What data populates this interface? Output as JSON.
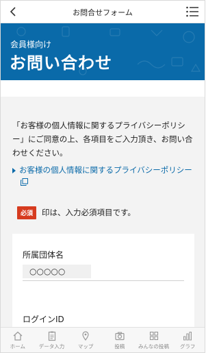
{
  "header": {
    "title": "お問合せフォーム"
  },
  "hero": {
    "subtitle": "会員様向け",
    "title": "お問い合わせ"
  },
  "intro": {
    "text": "「お客様の個人情報に関するプライバシーポリシー」にご同意の上、各項目をご入力頂き、お問い合わせください。"
  },
  "policy_link": {
    "label": "お客様の個人情報に関するプライバシーポリシー"
  },
  "required_note": {
    "badge": "必須",
    "text": "印は、入力必須項目です。"
  },
  "form": {
    "fields": [
      {
        "label": "所属団体名",
        "value": "○○○○○"
      },
      {
        "label": "ログインID",
        "value": ""
      }
    ]
  },
  "tabbar": {
    "tabs": [
      {
        "label": "ホーム",
        "icon": "home-icon"
      },
      {
        "label": "データ入力",
        "icon": "clipboard-icon"
      },
      {
        "label": "マップ",
        "icon": "map-pin-icon"
      },
      {
        "label": "投稿",
        "icon": "camera-icon"
      },
      {
        "label": "みんなの投稿",
        "icon": "grid-icon"
      },
      {
        "label": "グラフ",
        "icon": "bar-chart-icon"
      }
    ]
  },
  "colors": {
    "brand_blue": "#0a6aa9",
    "required_red": "#d63b1f",
    "content_bg": "#f3f3f3"
  }
}
